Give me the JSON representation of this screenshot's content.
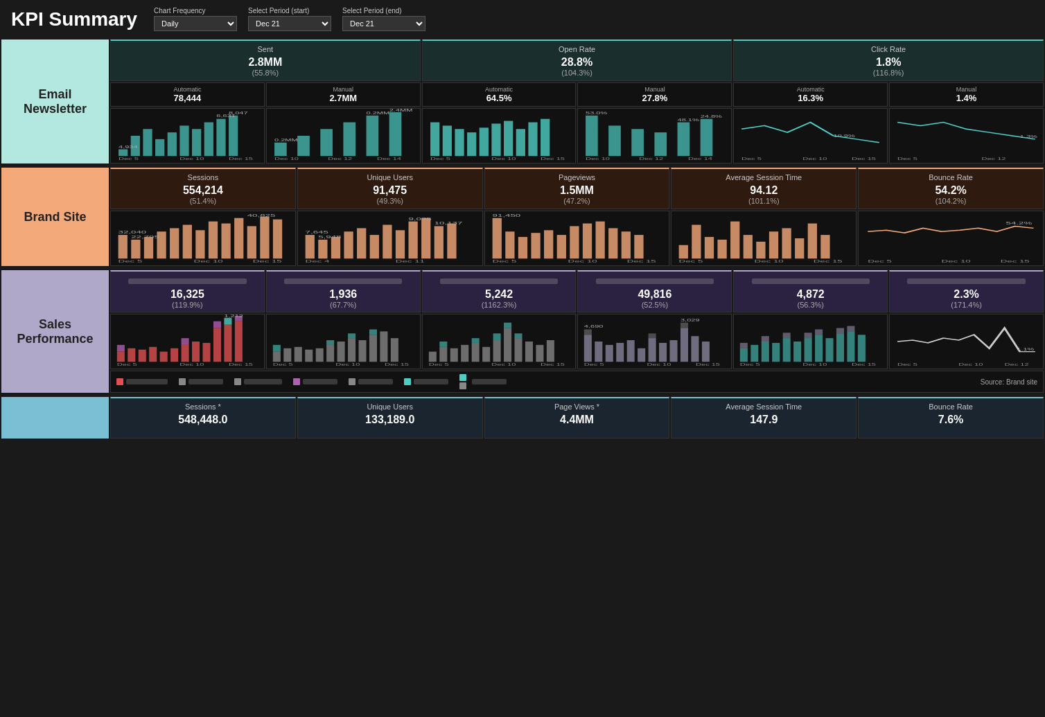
{
  "header": {
    "title": "KPI Summary",
    "chart_frequency_label": "Chart Frequency",
    "chart_frequency_value": "Daily",
    "period_start_label": "Select Period (start)",
    "period_start_value": "Dec 21",
    "period_end_label": "Select Period (end)",
    "period_end_value": "Dec 21"
  },
  "sections": {
    "email": {
      "label": "Email\nNewsletter",
      "metrics": {
        "sent": {
          "title": "Sent",
          "value": "2.8MM",
          "sub": "(55.8%)"
        },
        "open_rate": {
          "title": "Open Rate",
          "value": "28.8%",
          "sub": "(104.3%)"
        },
        "click_rate": {
          "title": "Click Rate",
          "value": "1.8%",
          "sub": "(116.8%)"
        }
      },
      "sub_metrics": {
        "sent_automatic": {
          "title": "Automatic",
          "value": "78,444"
        },
        "sent_manual": {
          "title": "Manual",
          "value": "2.7MM"
        },
        "open_automatic": {
          "title": "Automatic",
          "value": "64.5%"
        },
        "open_manual": {
          "title": "Manual",
          "value": "27.8%"
        },
        "click_automatic": {
          "title": "Automatic",
          "value": "16.3%"
        },
        "click_manual": {
          "title": "Manual",
          "value": "1.4%"
        }
      }
    },
    "brand": {
      "label": "Brand Site",
      "metrics": {
        "sessions": {
          "title": "Sessions",
          "value": "554,214",
          "sub": "(51.4%)"
        },
        "unique_users": {
          "title": "Unique Users",
          "value": "91,475",
          "sub": "(49.3%)"
        },
        "pageviews": {
          "title": "Pageviews",
          "value": "1.5MM",
          "sub": "(47.2%)"
        },
        "avg_session": {
          "title": "Average Session Time",
          "value": "94.12",
          "sub": "(101.1%)"
        },
        "bounce_rate": {
          "title": "Bounce Rate",
          "value": "54.2%",
          "sub": "(104.2%)"
        }
      }
    },
    "sales": {
      "label": "Sales\nPerformance",
      "metrics": {
        "m1": {
          "value": "16,325",
          "sub": "(119.9%)"
        },
        "m2": {
          "value": "1,936",
          "sub": "(67.7%)"
        },
        "m3": {
          "value": "5,242",
          "sub": "(1162.3%)"
        },
        "m4": {
          "value": "49,816",
          "sub": "(52.5%)"
        },
        "m5": {
          "value": "4,872",
          "sub": "(56.3%)"
        },
        "m6": {
          "value": "2.3%",
          "sub": "(171.4%)"
        }
      }
    },
    "bottom": {
      "label": "",
      "metrics": {
        "sessions": {
          "title": "Sessions *",
          "value": "548,448.0"
        },
        "unique_users": {
          "title": "Unique Users",
          "value": "133,189.0"
        },
        "page_views": {
          "title": "Page Views *",
          "value": "4.4MM"
        },
        "avg_session": {
          "title": "Average Session Time",
          "value": "147.9"
        },
        "bounce_rate": {
          "title": "Bounce Rate",
          "value": "7.6%"
        }
      }
    }
  },
  "legend": {
    "items": [
      {
        "color": "#e05050",
        "label": ""
      },
      {
        "color": "#888",
        "label": ""
      },
      {
        "color": "#888",
        "label": ""
      },
      {
        "color": "#b060b0",
        "label": ""
      },
      {
        "color": "#888",
        "label": ""
      },
      {
        "color": "#4ecdc4",
        "label": ""
      },
      {
        "color": "#888",
        "label": ""
      }
    ],
    "source": "Source: Brand site"
  },
  "chart_dates": {
    "email_sent": [
      "Dec 5",
      "Dec 10",
      "Dec 15"
    ],
    "brand": [
      "Dec 5",
      "Dec 10",
      "Dec 15"
    ]
  }
}
